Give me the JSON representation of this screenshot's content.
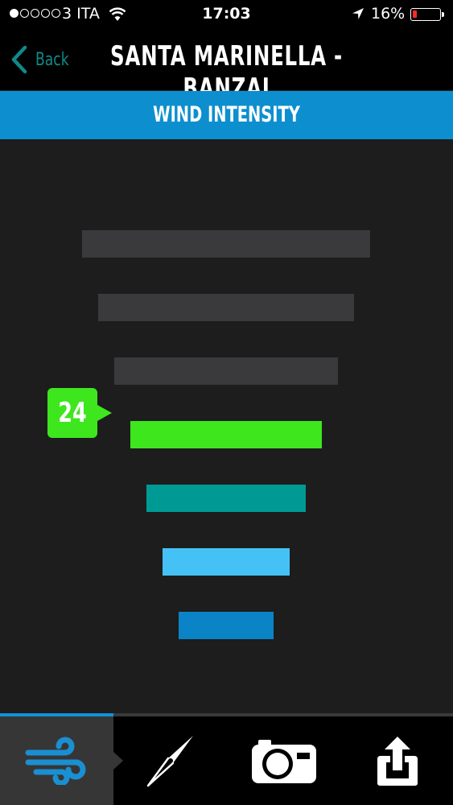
{
  "status_bar": {
    "carrier": "3 ITA",
    "time": "17:03",
    "battery_percent": "16%",
    "battery_level": 0.16,
    "signal_bars": 1,
    "icons": [
      "signal-dots-icon",
      "wifi-icon",
      "location-arrow-icon",
      "battery-icon"
    ]
  },
  "nav": {
    "back_label": "Back",
    "title": "SANTA MARINELLA - BANZAI"
  },
  "section": {
    "title": "WIND INTENSITY"
  },
  "wind_scale": {
    "current_value": "24",
    "active_level_index": 3,
    "levels": [
      {
        "color": "#3a3a3c"
      },
      {
        "color": "#3a3a3c"
      },
      {
        "color": "#3a3a3c"
      },
      {
        "color": "#3ee61e"
      },
      {
        "color": "#009a94"
      },
      {
        "color": "#45c2f5"
      },
      {
        "color": "#0a84c6"
      }
    ]
  },
  "tabs": [
    {
      "icon": "wind-icon",
      "active": true,
      "icon_color": "#1a8fd1"
    },
    {
      "icon": "compass-icon",
      "active": false
    },
    {
      "icon": "camera-icon",
      "active": false
    },
    {
      "icon": "share-icon",
      "active": false
    }
  ],
  "colors": {
    "accent": "#0d8fcf",
    "back": "#0f8a8a",
    "background": "#1d1d1d"
  }
}
